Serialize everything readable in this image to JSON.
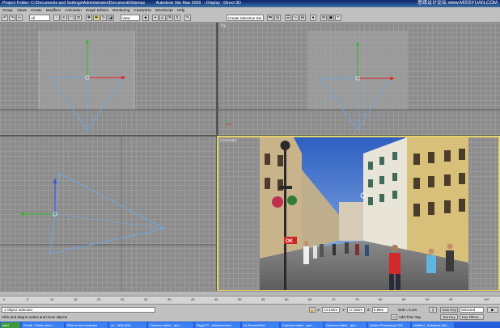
{
  "titlebar": {
    "left": "Project Folder: C:\\Documents and Settings\\Administrator\\Documenti\\3dsmax",
    "center": "Autodesk 3ds Max 2009",
    "right": "- Display : Direct 3D",
    "watermark": "思缘设计论坛 www.MISSYUAN.COM"
  },
  "menu": [
    "Group",
    "Views",
    "Create",
    "Modifiers",
    "Animation",
    "Graph Editors",
    "Rendering",
    "Customize",
    "MAXScript",
    "Help"
  ],
  "toolbar": {
    "filter": "All",
    "view": "View",
    "selection_set": "Create Selection Set"
  },
  "viewports": {
    "top_right_label": "Top",
    "bottom_right_label": "Camera01"
  },
  "timeline": {
    "ticks": [
      "0",
      "5",
      "10",
      "15",
      "20",
      "25",
      "30",
      "35",
      "40",
      "45",
      "50",
      "55",
      "60",
      "65",
      "70",
      "75",
      "80",
      "85",
      "90",
      "95",
      "100"
    ]
  },
  "status": {
    "selected": "1 Object Selected",
    "prompt": "Click and drag to select and move objects",
    "x_label": "X",
    "x_value": "14.432m",
    "y_label": "Y",
    "y_value": "17.352m",
    "z_label": "Z",
    "z_value": "5.89m",
    "grid": "Grid = 0,1m",
    "add_time_tag": "Add Time Tag",
    "auto_key": "Auto Key",
    "selected_dropdown": "Selected",
    "set_key": "Set Key",
    "key_filters": "Key Filters..."
  },
  "taskbar": [
    "start",
    "Gmail - Posta arrivo...",
    "Ritorno dal computer",
    "ne - MALAGA",
    "Camera match - que...",
    "Skype™ - stmkurscusco",
    "ee ScreenShot",
    "Camera match - que...",
    "Camera match - que...",
    "Adobe Photoshop CS3",
    "Untitled - Autodesk 3ds..."
  ]
}
